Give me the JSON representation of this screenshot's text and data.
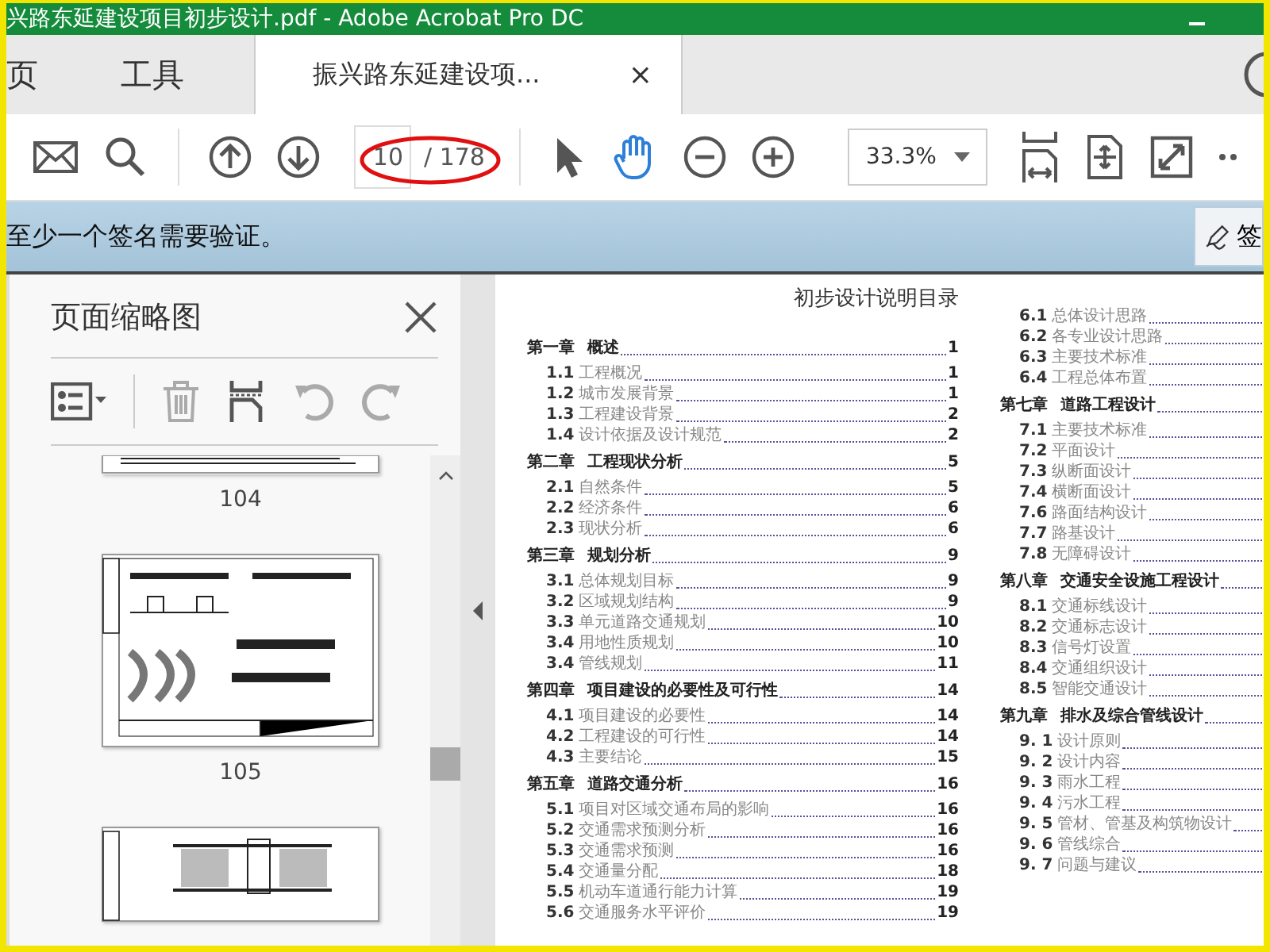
{
  "window": {
    "title": "兴路东延建设项目初步设计.pdf - Adobe Acrobat Pro DC"
  },
  "tabs": [
    {
      "label": "页",
      "selected": false
    },
    {
      "label": "工具",
      "selected": false
    },
    {
      "label": "振兴路东延建设项...",
      "selected": true,
      "close": "×"
    }
  ],
  "toolbar": {
    "page_field": "10",
    "page_total": "/ 178",
    "zoom": "33.3%",
    "tools": [
      {
        "kind": "select",
        "selected": false
      },
      {
        "kind": "hand",
        "selected": true
      }
    ]
  },
  "notice": {
    "text": "至少一个签名需要验证。",
    "button_label": "签"
  },
  "thumbnails_panel": {
    "title": "页面缩略图",
    "pages": [
      {
        "kind": "partial-top",
        "label": "104"
      },
      {
        "kind": "full",
        "label": "105"
      },
      {
        "kind": "partial-bottom"
      }
    ]
  },
  "document": {
    "title": "初步设计说明目录",
    "columns": [
      [
        {
          "kind": "chapter",
          "number": "第一章",
          "title": "概述",
          "page": "1"
        },
        {
          "kind": "section",
          "number": "1.1",
          "title": "工程概况",
          "page": "1"
        },
        {
          "kind": "section",
          "number": "1.2",
          "title": "城市发展背景",
          "page": "1"
        },
        {
          "kind": "section",
          "number": "1.3",
          "title": "工程建设背景",
          "page": "2"
        },
        {
          "kind": "section",
          "number": "1.4",
          "title": "设计依据及设计规范",
          "page": "2"
        },
        {
          "kind": "chapter",
          "number": "第二章",
          "title": "工程现状分析",
          "page": "5"
        },
        {
          "kind": "section",
          "number": "2.1",
          "title": "自然条件",
          "page": "5"
        },
        {
          "kind": "section",
          "number": "2.2",
          "title": "经济条件",
          "page": "6"
        },
        {
          "kind": "section",
          "number": "2.3",
          "title": "现状分析",
          "page": "6"
        },
        {
          "kind": "chapter",
          "number": "第三章",
          "title": "规划分析",
          "page": "9"
        },
        {
          "kind": "section",
          "number": "3.1",
          "title": "总体规划目标",
          "page": "9"
        },
        {
          "kind": "section",
          "number": "3.2",
          "title": "区域规划结构",
          "page": "9"
        },
        {
          "kind": "section",
          "number": "3.3",
          "title": "单元道路交通规划",
          "page": "10"
        },
        {
          "kind": "section",
          "number": "3.4",
          "title": "用地性质规划",
          "page": "10"
        },
        {
          "kind": "section",
          "number": "3.4",
          "title": "管线规划",
          "page": "11"
        },
        {
          "kind": "chapter",
          "number": "第四章",
          "title": "项目建设的必要性及可行性",
          "page": "14"
        },
        {
          "kind": "section",
          "number": "4.1",
          "title": "项目建设的必要性",
          "page": "14"
        },
        {
          "kind": "section",
          "number": "4.2",
          "title": "工程建设的可行性",
          "page": "14"
        },
        {
          "kind": "section",
          "number": "4.3",
          "title": "主要结论",
          "page": "15"
        },
        {
          "kind": "chapter",
          "number": "第五章",
          "title": "道路交通分析",
          "page": "16"
        },
        {
          "kind": "section",
          "number": "5.1",
          "title": "项目对区域交通布局的影响",
          "page": "16"
        },
        {
          "kind": "section",
          "number": "5.2",
          "title": "交通需求预测分析",
          "page": "16"
        },
        {
          "kind": "section",
          "number": "5.3",
          "title": "交通需求预测",
          "page": "16"
        },
        {
          "kind": "section",
          "number": "5.4",
          "title": "交通量分配",
          "page": "18"
        },
        {
          "kind": "section",
          "number": "5.5",
          "title": "机动车道通行能力计算",
          "page": "19"
        },
        {
          "kind": "section",
          "number": "5.6",
          "title": "交通服务水平评价",
          "page": "19"
        }
      ],
      [
        {
          "kind": "section",
          "number": "6.1",
          "title": "总体设计思路"
        },
        {
          "kind": "section",
          "number": "6.2",
          "title": "各专业设计思路"
        },
        {
          "kind": "section",
          "number": "6.3",
          "title": "主要技术标准"
        },
        {
          "kind": "section",
          "number": "6.4",
          "title": "工程总体布置"
        },
        {
          "kind": "chapter",
          "number": "第七章",
          "title": "道路工程设计"
        },
        {
          "kind": "section",
          "number": "7.1",
          "title": "主要技术标准"
        },
        {
          "kind": "section",
          "number": "7.2",
          "title": "平面设计"
        },
        {
          "kind": "section",
          "number": "7.3",
          "title": "纵断面设计"
        },
        {
          "kind": "section",
          "number": "7.4",
          "title": "横断面设计"
        },
        {
          "kind": "section",
          "number": "7.6",
          "title": "路面结构设计"
        },
        {
          "kind": "section",
          "number": "7.7",
          "title": "路基设计"
        },
        {
          "kind": "section",
          "number": "7.8",
          "title": "无障碍设计"
        },
        {
          "kind": "chapter",
          "number": "第八章",
          "title": "交通安全设施工程设计"
        },
        {
          "kind": "section",
          "number": "8.1",
          "title": "交通标线设计"
        },
        {
          "kind": "section",
          "number": "8.2",
          "title": "交通标志设计"
        },
        {
          "kind": "section",
          "number": "8.3",
          "title": "信号灯设置"
        },
        {
          "kind": "section",
          "number": "8.4",
          "title": "交通组织设计"
        },
        {
          "kind": "section",
          "number": "8.5",
          "title": "智能交通设计"
        },
        {
          "kind": "chapter",
          "number": "第九章",
          "title": "排水及综合管线设计"
        },
        {
          "kind": "section",
          "number": "9. 1",
          "title": "设计原则"
        },
        {
          "kind": "section",
          "number": "9. 2",
          "title": "设计内容"
        },
        {
          "kind": "section",
          "number": "9. 3",
          "title": "雨水工程"
        },
        {
          "kind": "section",
          "number": "9. 4",
          "title": "污水工程"
        },
        {
          "kind": "section",
          "number": "9. 5",
          "title": "管材、管基及构筑物设计"
        },
        {
          "kind": "section",
          "number": "9. 6",
          "title": "管线综合"
        },
        {
          "kind": "section",
          "number": "9. 7",
          "title": "问题与建议"
        }
      ]
    ]
  }
}
